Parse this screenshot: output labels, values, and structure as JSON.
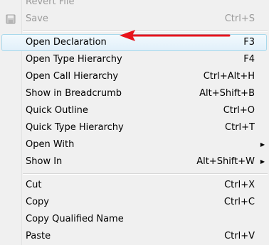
{
  "menu": {
    "items": [
      {
        "label": "Revert File",
        "shortcut": "",
        "disabled": true
      },
      {
        "label": "Save",
        "shortcut": "Ctrl+S",
        "disabled": true,
        "icon": "save-icon"
      },
      {
        "label": "Open Declaration",
        "shortcut": "F3",
        "highlighted": true
      },
      {
        "label": "Open Type Hierarchy",
        "shortcut": "F4"
      },
      {
        "label": "Open Call Hierarchy",
        "shortcut": "Ctrl+Alt+H"
      },
      {
        "label": "Show in Breadcrumb",
        "shortcut": "Alt+Shift+B"
      },
      {
        "label": "Quick Outline",
        "shortcut": "Ctrl+O"
      },
      {
        "label": "Quick Type Hierarchy",
        "shortcut": "Ctrl+T"
      },
      {
        "label": "Open With",
        "shortcut": "",
        "submenu": true
      },
      {
        "label": "Show In",
        "shortcut": "Alt+Shift+W",
        "submenu": true
      },
      {
        "label": "Cut",
        "shortcut": "Ctrl+X"
      },
      {
        "label": "Copy",
        "shortcut": "Ctrl+C"
      },
      {
        "label": "Copy Qualified Name",
        "shortcut": ""
      },
      {
        "label": "Paste",
        "shortcut": "Ctrl+V"
      }
    ]
  },
  "annotation": {
    "arrow_color": "#e8141c",
    "points_to": "Open Declaration"
  },
  "colors": {
    "highlight_border": "#a8d8eb",
    "disabled_text": "#9a9a9a"
  }
}
